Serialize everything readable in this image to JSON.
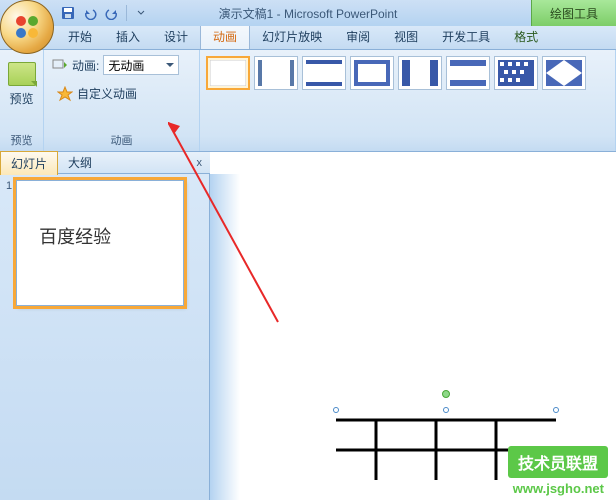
{
  "titlebar": {
    "title": "演示文稿1 - Microsoft PowerPoint",
    "context_tool": "绘图工具"
  },
  "tabs": {
    "items": [
      "开始",
      "插入",
      "设计",
      "动画",
      "幻灯片放映",
      "审阅",
      "视图",
      "开发工具",
      "格式"
    ],
    "active_index": 3
  },
  "ribbon": {
    "preview": {
      "label": "预览",
      "button": "预览"
    },
    "animation": {
      "label": "动画",
      "dropdown_label": "动画:",
      "dropdown_value": "无动画",
      "custom_label": "自定义动画"
    }
  },
  "panel": {
    "tabs": [
      "幻灯片",
      "大纲"
    ],
    "active_index": 0,
    "close": "x"
  },
  "slides": [
    {
      "number": "1",
      "content": "百度经验"
    }
  ],
  "watermark": {
    "badge": "技术员联盟",
    "url": "www.jsgho.net"
  }
}
